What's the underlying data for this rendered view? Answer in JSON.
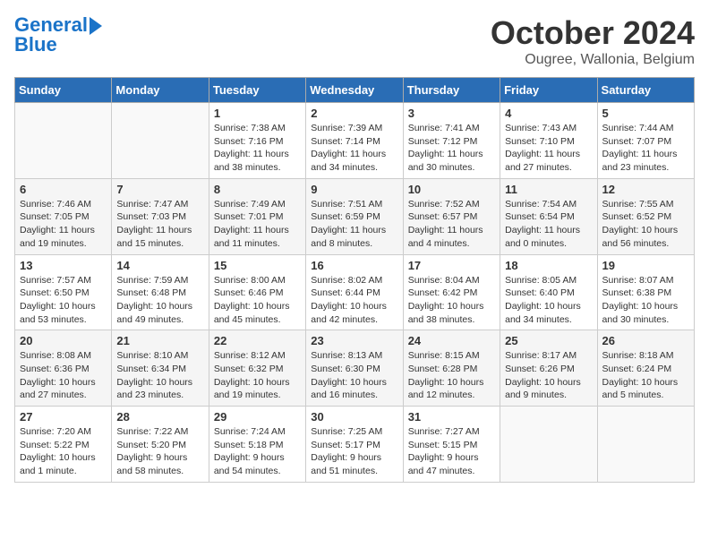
{
  "logo": {
    "line1": "General",
    "line2": "Blue"
  },
  "title": "October 2024",
  "subtitle": "Ougree, Wallonia, Belgium",
  "days_of_week": [
    "Sunday",
    "Monday",
    "Tuesday",
    "Wednesday",
    "Thursday",
    "Friday",
    "Saturday"
  ],
  "weeks": [
    [
      {
        "day": "",
        "info": ""
      },
      {
        "day": "",
        "info": ""
      },
      {
        "day": "1",
        "info": "Sunrise: 7:38 AM\nSunset: 7:16 PM\nDaylight: 11 hours and 38 minutes."
      },
      {
        "day": "2",
        "info": "Sunrise: 7:39 AM\nSunset: 7:14 PM\nDaylight: 11 hours and 34 minutes."
      },
      {
        "day": "3",
        "info": "Sunrise: 7:41 AM\nSunset: 7:12 PM\nDaylight: 11 hours and 30 minutes."
      },
      {
        "day": "4",
        "info": "Sunrise: 7:43 AM\nSunset: 7:10 PM\nDaylight: 11 hours and 27 minutes."
      },
      {
        "day": "5",
        "info": "Sunrise: 7:44 AM\nSunset: 7:07 PM\nDaylight: 11 hours and 23 minutes."
      }
    ],
    [
      {
        "day": "6",
        "info": "Sunrise: 7:46 AM\nSunset: 7:05 PM\nDaylight: 11 hours and 19 minutes."
      },
      {
        "day": "7",
        "info": "Sunrise: 7:47 AM\nSunset: 7:03 PM\nDaylight: 11 hours and 15 minutes."
      },
      {
        "day": "8",
        "info": "Sunrise: 7:49 AM\nSunset: 7:01 PM\nDaylight: 11 hours and 11 minutes."
      },
      {
        "day": "9",
        "info": "Sunrise: 7:51 AM\nSunset: 6:59 PM\nDaylight: 11 hours and 8 minutes."
      },
      {
        "day": "10",
        "info": "Sunrise: 7:52 AM\nSunset: 6:57 PM\nDaylight: 11 hours and 4 minutes."
      },
      {
        "day": "11",
        "info": "Sunrise: 7:54 AM\nSunset: 6:54 PM\nDaylight: 11 hours and 0 minutes."
      },
      {
        "day": "12",
        "info": "Sunrise: 7:55 AM\nSunset: 6:52 PM\nDaylight: 10 hours and 56 minutes."
      }
    ],
    [
      {
        "day": "13",
        "info": "Sunrise: 7:57 AM\nSunset: 6:50 PM\nDaylight: 10 hours and 53 minutes."
      },
      {
        "day": "14",
        "info": "Sunrise: 7:59 AM\nSunset: 6:48 PM\nDaylight: 10 hours and 49 minutes."
      },
      {
        "day": "15",
        "info": "Sunrise: 8:00 AM\nSunset: 6:46 PM\nDaylight: 10 hours and 45 minutes."
      },
      {
        "day": "16",
        "info": "Sunrise: 8:02 AM\nSunset: 6:44 PM\nDaylight: 10 hours and 42 minutes."
      },
      {
        "day": "17",
        "info": "Sunrise: 8:04 AM\nSunset: 6:42 PM\nDaylight: 10 hours and 38 minutes."
      },
      {
        "day": "18",
        "info": "Sunrise: 8:05 AM\nSunset: 6:40 PM\nDaylight: 10 hours and 34 minutes."
      },
      {
        "day": "19",
        "info": "Sunrise: 8:07 AM\nSunset: 6:38 PM\nDaylight: 10 hours and 30 minutes."
      }
    ],
    [
      {
        "day": "20",
        "info": "Sunrise: 8:08 AM\nSunset: 6:36 PM\nDaylight: 10 hours and 27 minutes."
      },
      {
        "day": "21",
        "info": "Sunrise: 8:10 AM\nSunset: 6:34 PM\nDaylight: 10 hours and 23 minutes."
      },
      {
        "day": "22",
        "info": "Sunrise: 8:12 AM\nSunset: 6:32 PM\nDaylight: 10 hours and 19 minutes."
      },
      {
        "day": "23",
        "info": "Sunrise: 8:13 AM\nSunset: 6:30 PM\nDaylight: 10 hours and 16 minutes."
      },
      {
        "day": "24",
        "info": "Sunrise: 8:15 AM\nSunset: 6:28 PM\nDaylight: 10 hours and 12 minutes."
      },
      {
        "day": "25",
        "info": "Sunrise: 8:17 AM\nSunset: 6:26 PM\nDaylight: 10 hours and 9 minutes."
      },
      {
        "day": "26",
        "info": "Sunrise: 8:18 AM\nSunset: 6:24 PM\nDaylight: 10 hours and 5 minutes."
      }
    ],
    [
      {
        "day": "27",
        "info": "Sunrise: 7:20 AM\nSunset: 5:22 PM\nDaylight: 10 hours and 1 minute."
      },
      {
        "day": "28",
        "info": "Sunrise: 7:22 AM\nSunset: 5:20 PM\nDaylight: 9 hours and 58 minutes."
      },
      {
        "day": "29",
        "info": "Sunrise: 7:24 AM\nSunset: 5:18 PM\nDaylight: 9 hours and 54 minutes."
      },
      {
        "day": "30",
        "info": "Sunrise: 7:25 AM\nSunset: 5:17 PM\nDaylight: 9 hours and 51 minutes."
      },
      {
        "day": "31",
        "info": "Sunrise: 7:27 AM\nSunset: 5:15 PM\nDaylight: 9 hours and 47 minutes."
      },
      {
        "day": "",
        "info": ""
      },
      {
        "day": "",
        "info": ""
      }
    ]
  ]
}
